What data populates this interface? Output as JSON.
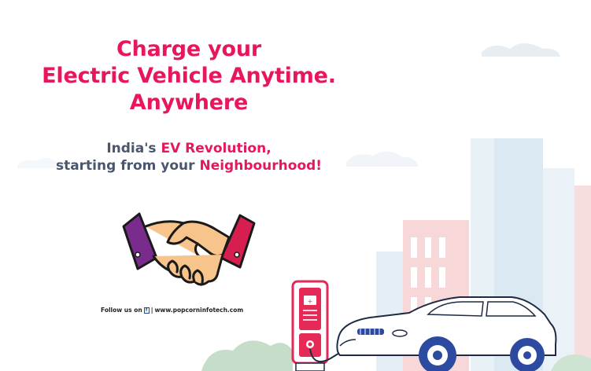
{
  "headline": {
    "line1": "Charge your",
    "line2": "Electric Vehicle Anytime.",
    "line3": "Anywhere"
  },
  "tagline": {
    "part1": "India's ",
    "accent1": "EV Revolution,",
    "part2": "starting from your ",
    "accent2": "Neighbourhood!"
  },
  "footer": {
    "follow_label": "Follow us on",
    "separator": "|",
    "website": "www.popcorninfotech.com",
    "social_icon": "facebook-icon"
  },
  "colors": {
    "brand_pink": "#e8175d",
    "slate_text": "#4a5670",
    "building_blue": "#d9e9f1",
    "building_pink": "#f6d2d2",
    "bush_green": "#bcd8c1",
    "charger_red": "#e52a57"
  }
}
